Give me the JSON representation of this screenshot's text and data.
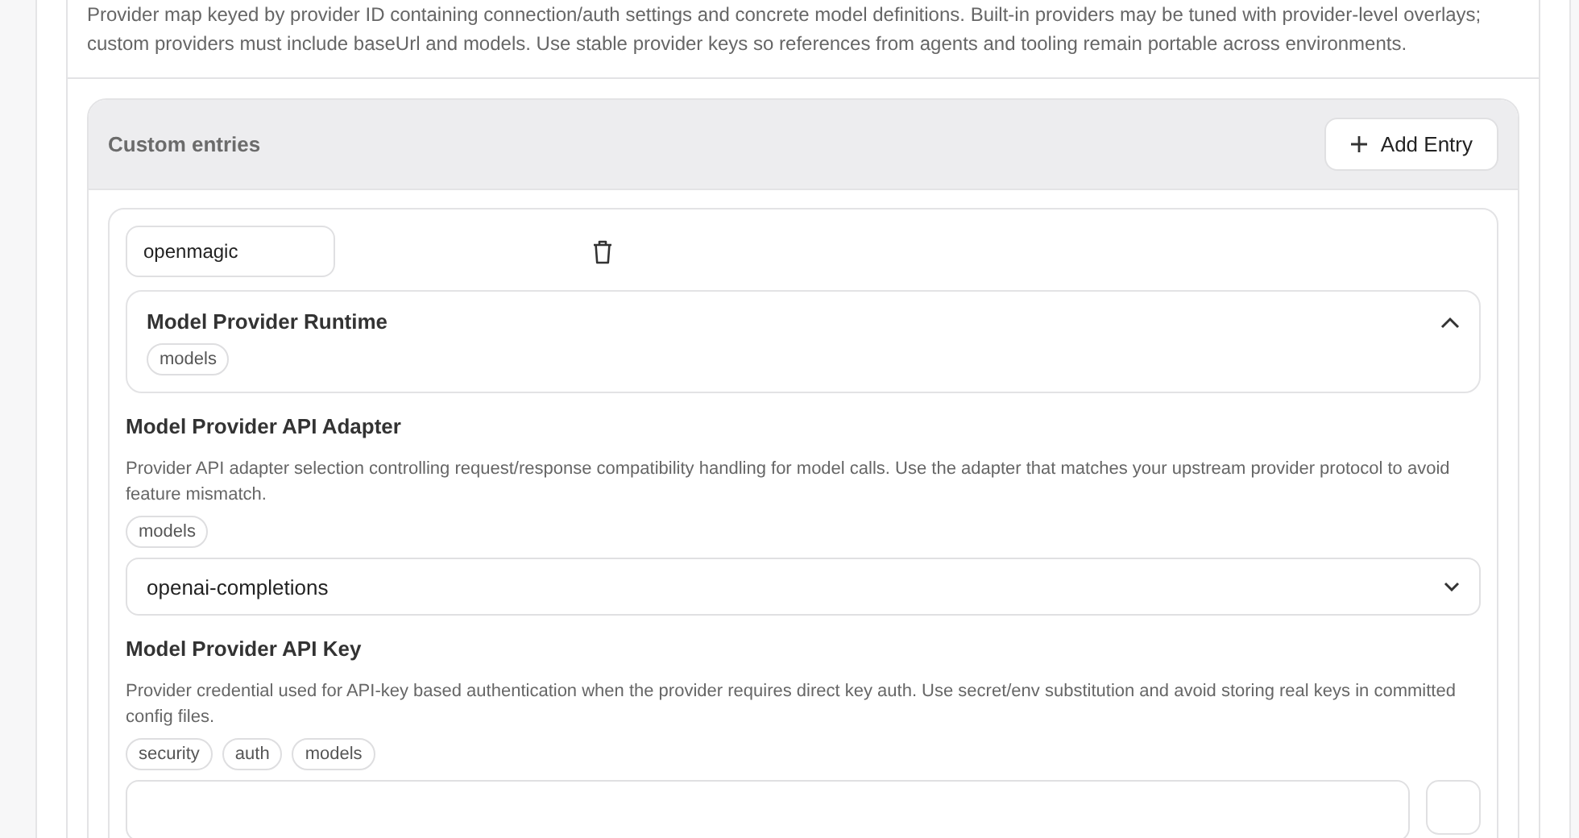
{
  "description": "Provider map keyed by provider ID containing connection/auth settings and concrete model definitions. Built-in providers may be tuned with provider-level overlays; custom providers must include baseUrl and models. Use stable provider keys so references from agents and tooling remain portable across environments.",
  "custom_entries": {
    "title": "Custom entries",
    "add_button": "Add Entry",
    "entries": [
      {
        "key": "openmagic",
        "runtime": {
          "title": "Model Provider Runtime",
          "expanded": true,
          "tags": [
            "models"
          ]
        },
        "fields": [
          {
            "kind": "select",
            "label": "Model Provider API Adapter",
            "description": "Provider API adapter selection controlling request/response compatibility handling for model calls. Use the adapter that matches your upstream provider protocol to avoid feature mismatch.",
            "tags": [
              "models"
            ],
            "value": "openai-completions"
          },
          {
            "kind": "secret",
            "label": "Model Provider API Key",
            "description": "Provider credential used for API-key based authentication when the provider requires direct key auth. Use secret/env substitution and avoid storing real keys in committed config files.",
            "tags": [
              "security",
              "auth",
              "models"
            ]
          }
        ]
      }
    ]
  }
}
